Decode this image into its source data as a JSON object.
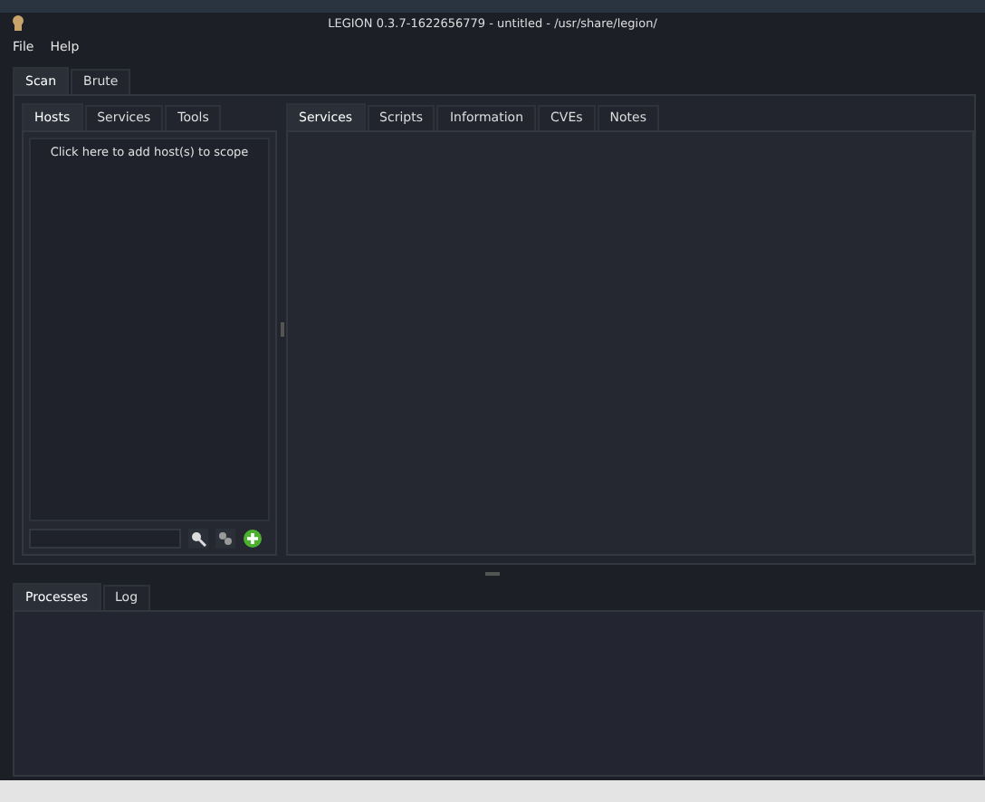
{
  "window": {
    "title": "LEGION 0.3.7-1622656779 - untitled - /usr/share/legion/"
  },
  "menu": [
    "File",
    "Help"
  ],
  "main_tabs": [
    {
      "label": "Scan",
      "selected": true
    },
    {
      "label": "Brute",
      "selected": false
    }
  ],
  "left_tabs": [
    {
      "label": "Hosts",
      "selected": true
    },
    {
      "label": "Services",
      "selected": false
    },
    {
      "label": "Tools",
      "selected": false
    }
  ],
  "hosts_hint": "Click here to add host(s) to scope",
  "right_tabs": [
    {
      "label": "Services",
      "selected": true
    },
    {
      "label": "Scripts",
      "selected": false
    },
    {
      "label": "Information",
      "selected": false
    },
    {
      "label": "CVEs",
      "selected": false
    },
    {
      "label": "Notes",
      "selected": false
    }
  ],
  "bottom_tabs": [
    {
      "label": "Processes",
      "selected": true
    },
    {
      "label": "Log",
      "selected": false
    }
  ]
}
